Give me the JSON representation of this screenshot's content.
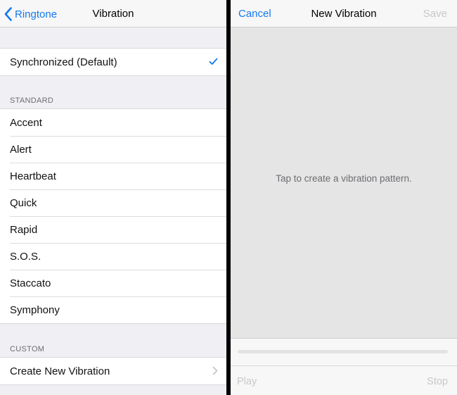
{
  "left": {
    "back_label": "Ringtone",
    "title": "Vibration",
    "default_option": "Synchronized (Default)",
    "standard_header": "STANDARD",
    "standard_items": [
      "Accent",
      "Alert",
      "Heartbeat",
      "Quick",
      "Rapid",
      "S.O.S.",
      "Staccato",
      "Symphony"
    ],
    "custom_header": "CUSTOM",
    "create_label": "Create New Vibration"
  },
  "right": {
    "cancel_label": "Cancel",
    "title": "New Vibration",
    "save_label": "Save",
    "hint": "Tap to create a vibration pattern.",
    "play_label": "Play",
    "stop_label": "Stop"
  },
  "colors": {
    "accent": "#1479ef",
    "disabled": "#c8c8cc",
    "background": "#efeff4",
    "recording_area": "#e5e5e5"
  }
}
